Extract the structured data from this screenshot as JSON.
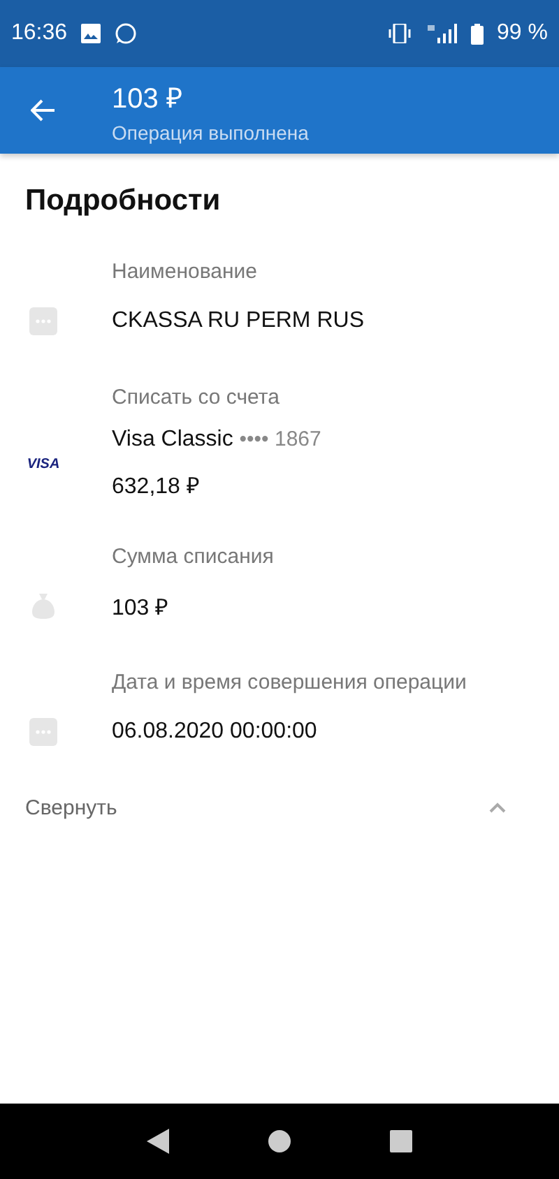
{
  "status_bar": {
    "time": "16:36",
    "battery": "99 %"
  },
  "app_bar": {
    "title": "103 ₽",
    "subtitle": "Операция выполнена"
  },
  "section_title": "Подробности",
  "details": [
    {
      "kind": "dots",
      "label": "Наименование",
      "value": "CKASSA RU PERM RUS"
    },
    {
      "kind": "card",
      "label": "Списать со счета",
      "logo": "VISA",
      "value": "Visa Classic",
      "suffix": "•••• 1867",
      "extra": "632,18 ₽"
    },
    {
      "kind": "bag",
      "label": "Сумма списания",
      "value": "103 ₽"
    },
    {
      "kind": "dots",
      "label": "Дата и время совершения операции",
      "value": "06.08.2020 00:00:00"
    }
  ],
  "collapse": {
    "label": "Свернуть",
    "expanded": true
  }
}
